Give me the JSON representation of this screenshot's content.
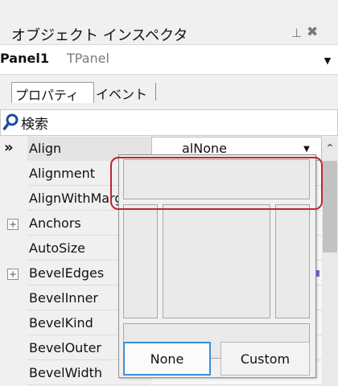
{
  "panel": {
    "title": "オブジェクト インスペクタ",
    "pin_icon": "pin-icon",
    "close_icon": "close-icon"
  },
  "selector": {
    "component_name": "Panel1",
    "component_type": "TPanel"
  },
  "tabs": [
    {
      "label": "プロパティ",
      "active": true
    },
    {
      "label": "イベント",
      "active": false
    }
  ],
  "search": {
    "label": "検索"
  },
  "properties": [
    {
      "name": "Align",
      "value": "alNone",
      "selected": true
    },
    {
      "name": "Alignment"
    },
    {
      "name": "AlignWithMargins"
    },
    {
      "name": "Anchors",
      "expandable": true
    },
    {
      "name": "AutoSize"
    },
    {
      "name": "BevelEdges",
      "expandable": true
    },
    {
      "name": "BevelInner"
    },
    {
      "name": "BevelKind"
    },
    {
      "name": "BevelOuter"
    },
    {
      "name": "BevelWidth"
    }
  ],
  "popup": {
    "none_label": "None",
    "custom_label": "Custom"
  },
  "colors": {
    "highlight": "#c0262a",
    "focus": "#3c8ed6"
  }
}
